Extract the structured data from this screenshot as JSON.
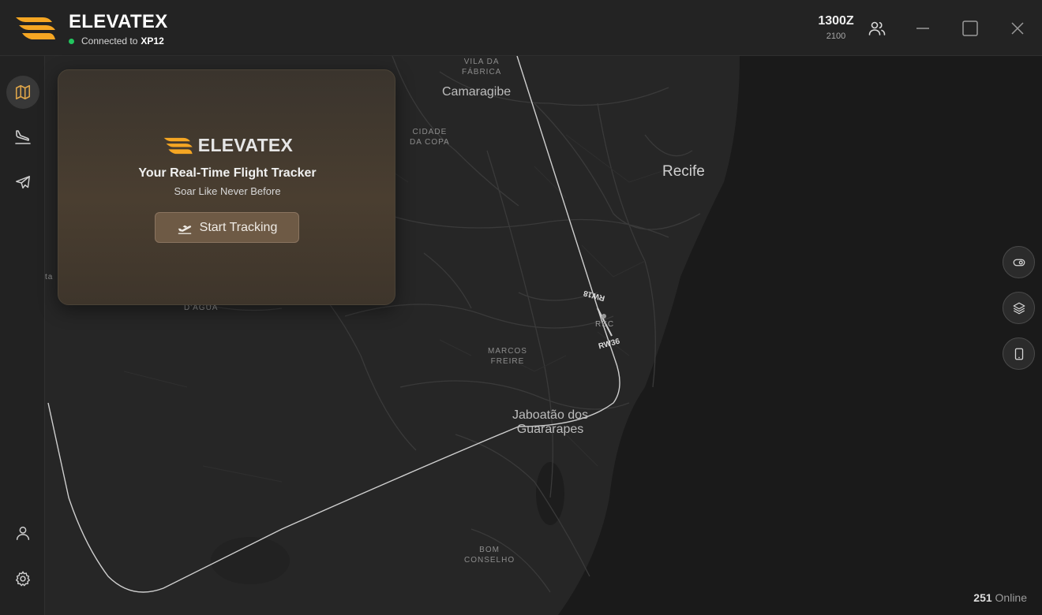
{
  "app": {
    "name": "ELEVATEX",
    "connection_prefix": "Connected to",
    "connection_target": "XP12"
  },
  "clock": {
    "zulu": "1300Z",
    "local": "2100"
  },
  "icons": {
    "users": "users-icon",
    "minimize": "minimize-icon",
    "maximize": "maximize-icon",
    "close": "close-icon",
    "map": "map-icon",
    "arrivals": "landing-icon",
    "flights": "airplane-icon",
    "profile": "user-icon",
    "settings": "gear-icon",
    "visibility": "eye-toggle-icon",
    "layers": "layers-icon",
    "device": "tablet-icon",
    "takeoff": "takeoff-icon"
  },
  "card": {
    "brand": "ELEVATEX",
    "tagline": "Your Real-Time Flight Tracker",
    "subtitle": "Soar Like Never Before",
    "button": "Start Tracking"
  },
  "map": {
    "labels": {
      "vila_da_fabrica": "VILA DA\nFÁBRICA",
      "camaragibe": "Camaragibe",
      "cidade_da_copa": "CIDADE\nDA COPA",
      "recife": "Recife",
      "rw18": "RW18",
      "rec": "REC",
      "rw36": "RW36",
      "marcos_freire": "MARCOS\nFREIRE",
      "jaboatao": "Jaboatão dos\nGuararapes",
      "bom_conselho": "BOM\nCONSELHO",
      "d_agua": "D'ÁGUA",
      "partial_ta": "ta"
    }
  },
  "status": {
    "online_count": "251",
    "online_label": "Online"
  },
  "colors": {
    "accent": "#f5a623",
    "status_connected": "#22c55e"
  }
}
